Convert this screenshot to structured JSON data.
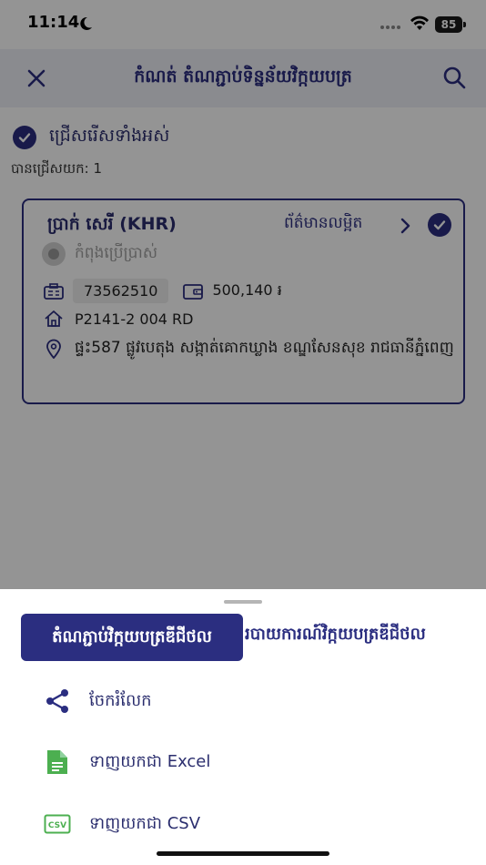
{
  "status_bar": {
    "time": "11:14",
    "battery": "85"
  },
  "app_bar": {
    "title": "កំណត់ តំណភ្ជាប់ទិន្នន័យវិក្កយបត្រ"
  },
  "selection": {
    "select_all_label": "ជ្រើសរើសទាំងអស់",
    "selected_count": "បានជ្រើសយក: 1"
  },
  "card": {
    "name": "ប្រាក់ សេរី (KHR)",
    "detail_link": "ព័ត៌មានលម្អិត",
    "status": "កំពុងប្រើប្រាស់",
    "meter_number": "73562510",
    "balance": "500,140 ៛",
    "property_code": "P2141-2 004 RD",
    "address": "ផ្ទះ587 ផ្លូវបេតុង  សង្កាត់គោកឃ្លាង ខណ្ឌសែនសុខ រាជធានីភ្នំពេញ"
  },
  "sheet": {
    "tabs": [
      {
        "label": "តំណភ្ជាប់វិក្កយបត្រឌីជីថល",
        "active": true
      },
      {
        "label": "របាយការណ៍វិក្កយបត្រឌីជីថល",
        "active": false
      }
    ],
    "items": [
      {
        "label": "ចែករំលែក",
        "icon": "share-icon"
      },
      {
        "label": "ទាញយកជា Excel",
        "icon": "excel-file-icon"
      },
      {
        "label": "ទាញយកជា CSV",
        "icon": "csv-file-icon"
      }
    ]
  },
  "colors": {
    "primary": "#2b2e80",
    "excel_green": "#4caf50",
    "overlay": "rgba(0,0,0,0.42)"
  }
}
